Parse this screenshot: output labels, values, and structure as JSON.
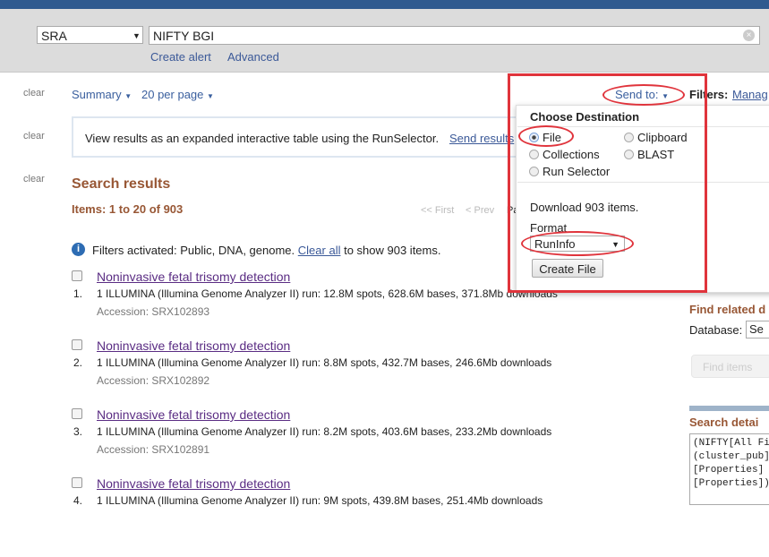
{
  "header": {
    "database": "SRA",
    "query": "NIFTY BGI",
    "create_alert": "Create alert",
    "advanced": "Advanced"
  },
  "toolbar": {
    "clear": "clear",
    "summary": "Summary",
    "per_page": "20 per page",
    "send_to": "Send to:",
    "filters": "Filters:",
    "manage": "Manag"
  },
  "notice": {
    "text": "View results as an expanded interactive table using the RunSelector.",
    "link": "Send results"
  },
  "results": {
    "heading": "Search results",
    "items": "Items: 1 to 20 of 903",
    "first": "<< First",
    "prev": "< Prev",
    "page": "Pa",
    "filters_text": "Filters activated: Public, DNA, genome.",
    "clear_all": "Clear all",
    "filters_suffix": "to show 903 items.",
    "list": [
      {
        "num": "1.",
        "title": "Noninvasive fetal trisomy detection",
        "desc": "1 ILLUMINA (Illumina Genome Analyzer II) run: 12.8M spots, 628.6M bases, 371.8Mb downloads",
        "accession": "Accession: SRX102893"
      },
      {
        "num": "2.",
        "title": "Noninvasive fetal trisomy detection",
        "desc": "1 ILLUMINA (Illumina Genome Analyzer II) run: 8.8M spots, 432.7M bases, 246.6Mb downloads",
        "accession": "Accession: SRX102892"
      },
      {
        "num": "3.",
        "title": "Noninvasive fetal trisomy detection",
        "desc": "1 ILLUMINA (Illumina Genome Analyzer II) run: 8.2M spots, 403.6M bases, 233.2Mb downloads",
        "accession": "Accession: SRX102891"
      },
      {
        "num": "4.",
        "title": "Noninvasive fetal trisomy detection",
        "desc": "1 ILLUMINA (Illumina Genome Analyzer II) run: 9M spots, 439.8M bases, 251.4Mb downloads",
        "accession": ""
      }
    ]
  },
  "send_to": {
    "heading": "Choose Destination",
    "options": [
      "File",
      "Clipboard",
      "Collections",
      "BLAST",
      "Run Selector"
    ],
    "selected": "File",
    "download": "Download 903 items.",
    "format_label": "Format",
    "format": "RunInfo",
    "create": "Create File"
  },
  "sidebar": {
    "find_related": "Find related d",
    "database_label": "Database:",
    "database_value": "Se",
    "find_items": "Find items",
    "search_details": "Search detai",
    "details_lines": [
      "(NIFTY[All Fi",
      "(cluster_pub]",
      "[Properties]",
      "[Properties])"
    ]
  },
  "colors": {
    "highlight": "#e0343c",
    "heading": "#985735",
    "link": "#3b5998"
  }
}
